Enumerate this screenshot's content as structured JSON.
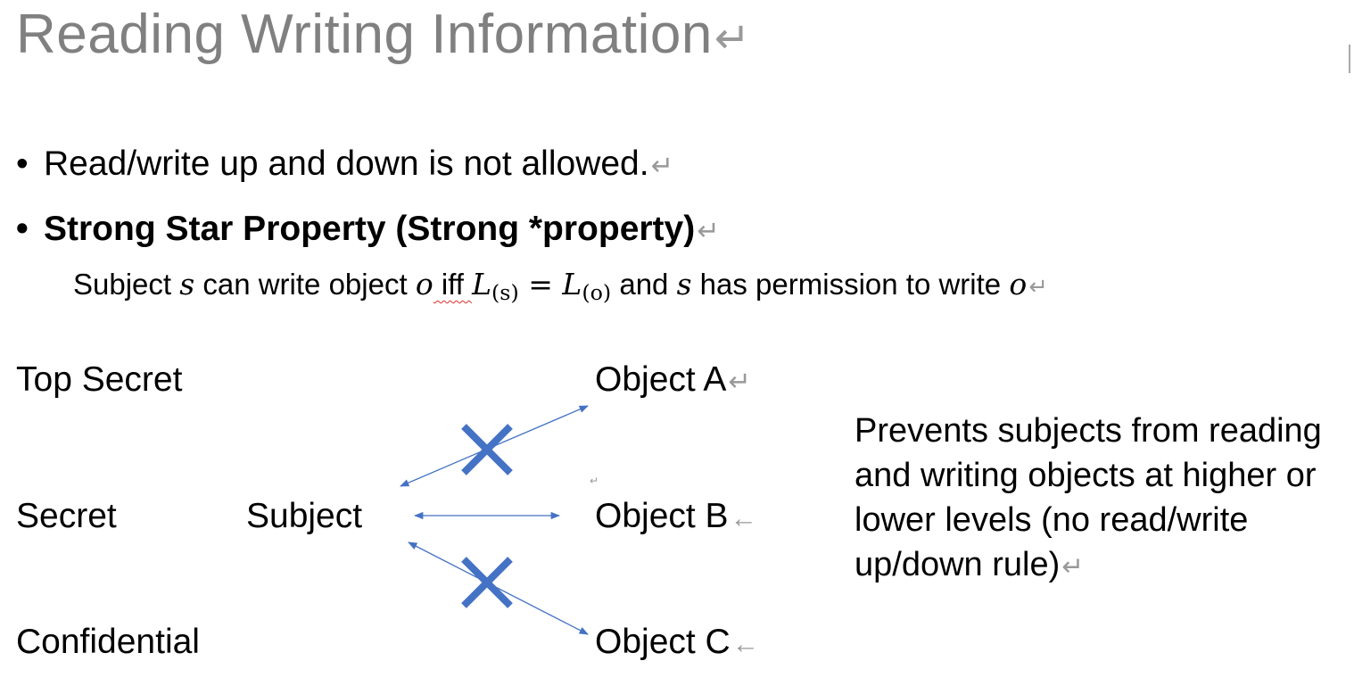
{
  "title": "Reading Writing Information",
  "bullets": [
    "Read/write up and down is not allowed.",
    "Strong Star Property (Strong *property)"
  ],
  "rule": {
    "t1": "Subject ",
    "s": "s",
    "t2": " can write object ",
    "o": "o",
    "t3": " iff ",
    "eq_left": "L",
    "eq_left_sub": "(s)",
    "eq_sign": " = ",
    "eq_right": "L",
    "eq_right_sub": "(o)",
    "t4": " and ",
    "t5": " has permission to write "
  },
  "levels": [
    "Top Secret",
    "Secret",
    "Confidential"
  ],
  "subject_label": "Subject",
  "objects": [
    "Object A",
    "Object B",
    "Object C"
  ],
  "note": "Prevents subjects from reading and writing objects at higher or lower levels (no read/write up/down rule)",
  "paragraph_mark": "↵",
  "arrow_mark": "←",
  "colors": {
    "title": "#808080",
    "arrow": "#4472c4",
    "cross": "#4472c4"
  }
}
